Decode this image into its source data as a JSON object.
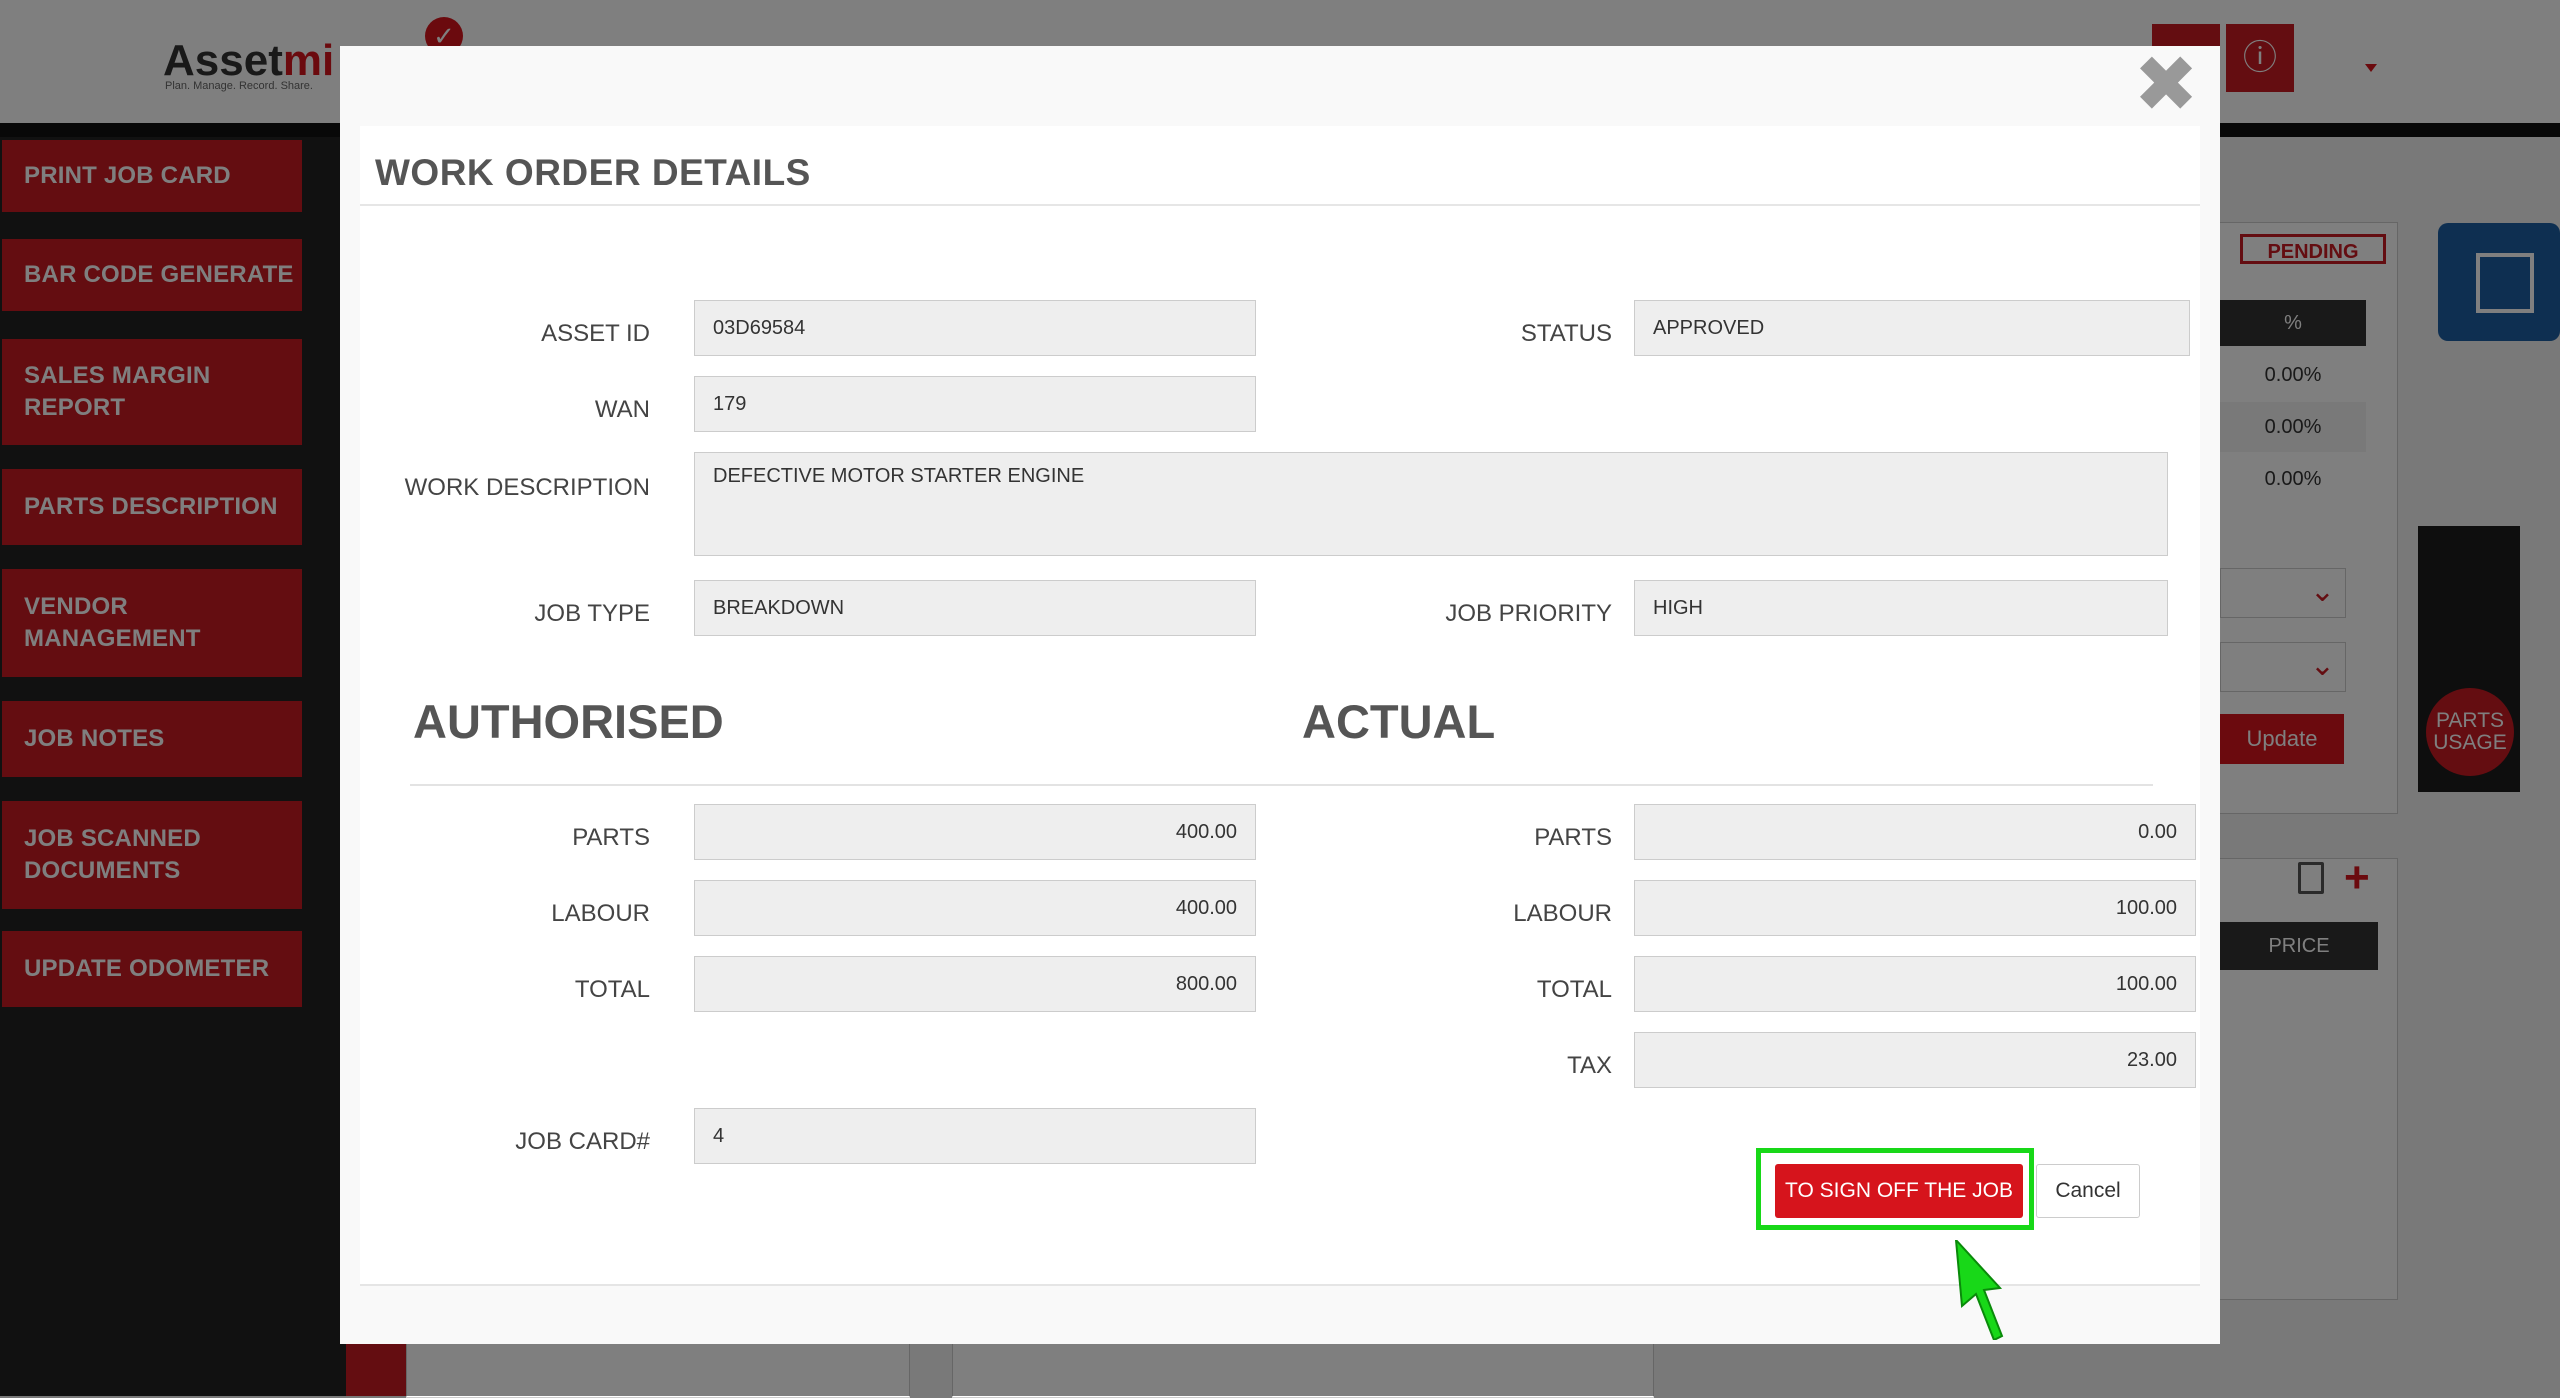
{
  "app": {
    "logo_text": "Assetmi",
    "logo_tagline": "Plan. Manage. Record. Share."
  },
  "sidebar": {
    "items": [
      {
        "label": "PRINT JOB CARD"
      },
      {
        "label": "BAR CODE GENERATE"
      },
      {
        "label": "SALES MARGIN REPORT"
      },
      {
        "label": "PARTS DESCRIPTION"
      },
      {
        "label": "VENDOR MANAGEMENT"
      },
      {
        "label": "JOB NOTES"
      },
      {
        "label": "JOB SCANNED DOCUMENTS"
      },
      {
        "label": "UPDATE ODOMETER"
      }
    ]
  },
  "background_panel": {
    "status_badge": "PENDING",
    "pct_header": "%",
    "pct_values": [
      "0.00%",
      "0.00%",
      "0.00%"
    ],
    "update_label": "Update",
    "parts_usage_label": "PARTS USAGE",
    "price_header": "PRICE"
  },
  "modal": {
    "title": "WORK ORDER DETAILS",
    "close_glyph": "✖",
    "fields": {
      "asset_id": {
        "label": "ASSET ID",
        "value": "03D69584"
      },
      "status": {
        "label": "STATUS",
        "value": "APPROVED"
      },
      "wan": {
        "label": "WAN",
        "value": "179"
      },
      "work_description": {
        "label": "WORK DESCRIPTION",
        "value": "DEFECTIVE MOTOR STARTER ENGINE"
      },
      "job_type": {
        "label": "JOB TYPE",
        "value": "BREAKDOWN"
      },
      "job_priority": {
        "label": "JOB PRIORITY",
        "value": "HIGH"
      }
    },
    "authorised": {
      "heading": "AUTHORISED",
      "parts": {
        "label": "PARTS",
        "value": "400.00"
      },
      "labour": {
        "label": "LABOUR",
        "value": "400.00"
      },
      "total": {
        "label": "TOTAL",
        "value": "800.00"
      },
      "job_card": {
        "label": "JOB CARD#",
        "value": "4"
      }
    },
    "actual": {
      "heading": "ACTUAL",
      "parts": {
        "label": "PARTS",
        "value": "0.00"
      },
      "labour": {
        "label": "LABOUR",
        "value": "100.00"
      },
      "total": {
        "label": "TOTAL",
        "value": "100.00"
      },
      "tax": {
        "label": "TAX",
        "value": "23.00"
      }
    },
    "sign_off_label": "TO SIGN OFF THE JOB",
    "cancel_label": "Cancel"
  },
  "colors": {
    "brand_red": "#d6141c",
    "highlight_green": "#18d818"
  }
}
